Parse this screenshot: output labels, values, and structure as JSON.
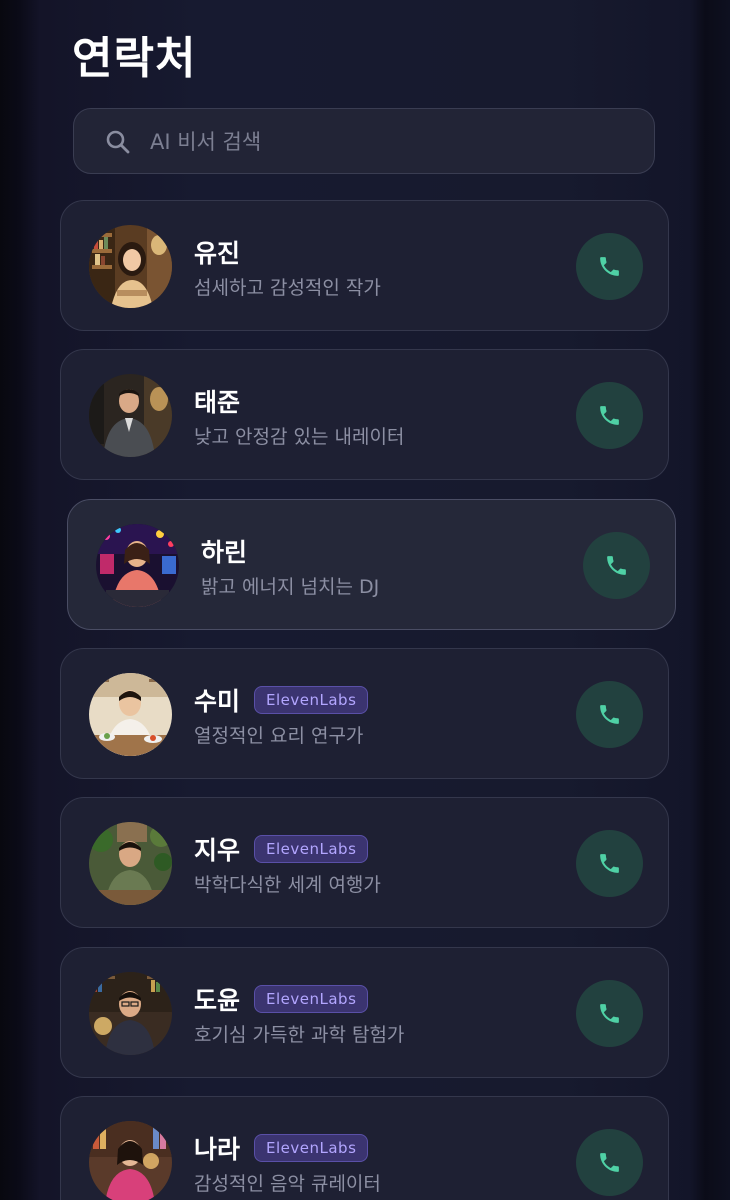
{
  "page": {
    "title": "연락처"
  },
  "search": {
    "placeholder": "AI 비서 검색",
    "value": ""
  },
  "badge_label": "ElevenLabs",
  "colors": {
    "background": "#171a30",
    "card": "#1e2033",
    "call_button": "#22413f",
    "call_icon": "#4fd1a5",
    "badge_bg": "#3b3470",
    "badge_text": "#b3a6ff"
  },
  "contacts": [
    {
      "name": "유진",
      "description": "섬세하고 감성적인 작가",
      "badge": "",
      "avatar_icon": "writer-portrait"
    },
    {
      "name": "태준",
      "description": "낮고 안정감 있는 내레이터",
      "badge": "",
      "avatar_icon": "narrator-portrait"
    },
    {
      "name": "하린",
      "description": "밝고 에너지 넘치는 DJ",
      "badge": "",
      "avatar_icon": "dj-portrait"
    },
    {
      "name": "수미",
      "description": "열정적인 요리 연구가",
      "badge": "ElevenLabs",
      "avatar_icon": "chef-portrait"
    },
    {
      "name": "지우",
      "description": "박학다식한 세계 여행가",
      "badge": "ElevenLabs",
      "avatar_icon": "traveler-portrait"
    },
    {
      "name": "도윤",
      "description": "호기심 가득한 과학 탐험가",
      "badge": "ElevenLabs",
      "avatar_icon": "scientist-portrait"
    },
    {
      "name": "나라",
      "description": "감성적인 음악 큐레이터",
      "badge": "ElevenLabs",
      "avatar_icon": "music-curator-portrait"
    }
  ]
}
